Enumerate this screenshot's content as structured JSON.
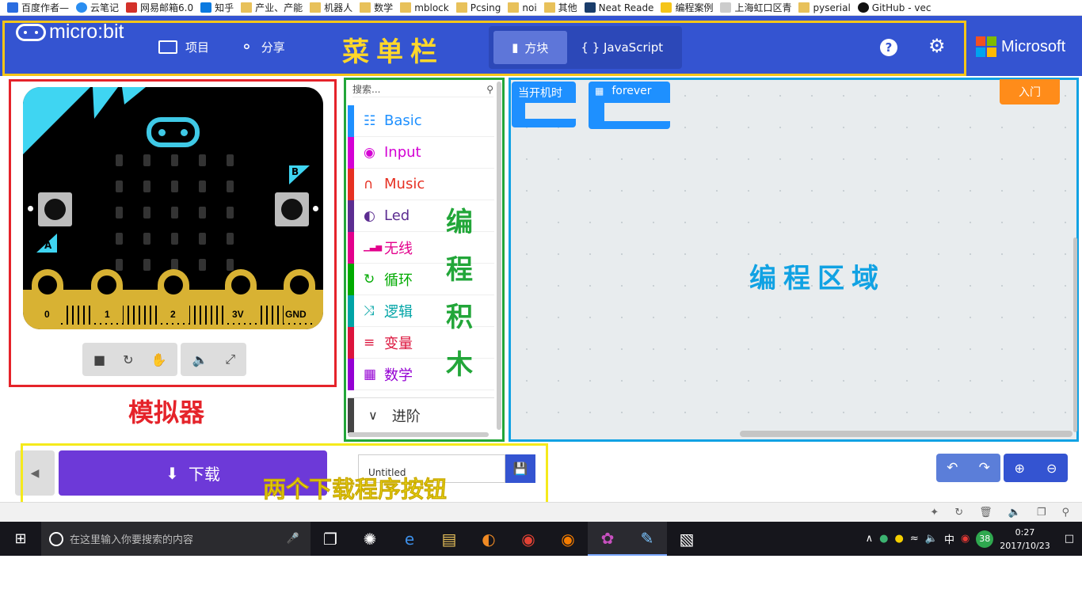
{
  "bookmarks": [
    {
      "label": "百度作者—"
    },
    {
      "label": "云笔记"
    },
    {
      "label": "网易邮箱6.0"
    },
    {
      "label": "知乎"
    },
    {
      "label": "产业、产能"
    },
    {
      "label": "机器人"
    },
    {
      "label": "数学"
    },
    {
      "label": "mblock"
    },
    {
      "label": "Pcsing"
    },
    {
      "label": "noi"
    },
    {
      "label": "其他"
    },
    {
      "label": "Neat Reade"
    },
    {
      "label": "编程案例"
    },
    {
      "label": "上海虹口区青"
    },
    {
      "label": "pyserial"
    },
    {
      "label": "GitHub - vec"
    }
  ],
  "menubar": {
    "logo_text": "micro:bit",
    "projects_label": "项目",
    "share_label": "分享",
    "annotation": "菜单栏",
    "blocks_label": "方块",
    "javascript_label": "{ } JavaScript",
    "help_icon": "?",
    "microsoft_label": "Microsoft",
    "brand_color": "#3454d1"
  },
  "simulator": {
    "pins": [
      "0",
      "1",
      "2",
      "3V",
      "GND"
    ],
    "button_a": "A",
    "button_b": "B",
    "caption": "模拟器"
  },
  "toolbox": {
    "search_placeholder": "搜索...",
    "categories": [
      {
        "label": "Basic",
        "color": "#1e90ff",
        "icon": "grid-icon"
      },
      {
        "label": "Input",
        "color": "#d400d4",
        "icon": "radio-target-icon"
      },
      {
        "label": "Music",
        "color": "#e63022",
        "icon": "headphones-icon"
      },
      {
        "label": "Led",
        "color": "#5c2d91",
        "icon": "toggle-icon"
      },
      {
        "label": "无线",
        "color": "#e3008c",
        "icon": "signal-icon"
      },
      {
        "label": "循环",
        "color": "#00aa00",
        "icon": "loop-icon"
      },
      {
        "label": "逻辑",
        "color": "#00a4a6",
        "icon": "shuffle-icon"
      },
      {
        "label": "变量",
        "color": "#dc143c",
        "icon": "list-icon"
      },
      {
        "label": "数学",
        "color": "#9400d3",
        "icon": "calculator-icon"
      }
    ],
    "advanced_label": "进阶",
    "caption": [
      "编",
      "程",
      "积",
      "木"
    ]
  },
  "editor": {
    "on_start_label": "当开机时",
    "forever_label": "forever",
    "getting_started_label": "入门",
    "caption": "编程区域"
  },
  "bottombar": {
    "download_label": "下载",
    "project_name": "Untitled",
    "caption": "两个下载程序按钮"
  },
  "taskbar": {
    "search_placeholder": "在这里输入你要搜索的内容",
    "time": "0:27",
    "date": "2017/10/23",
    "ime": "中",
    "badge_count": "38"
  }
}
